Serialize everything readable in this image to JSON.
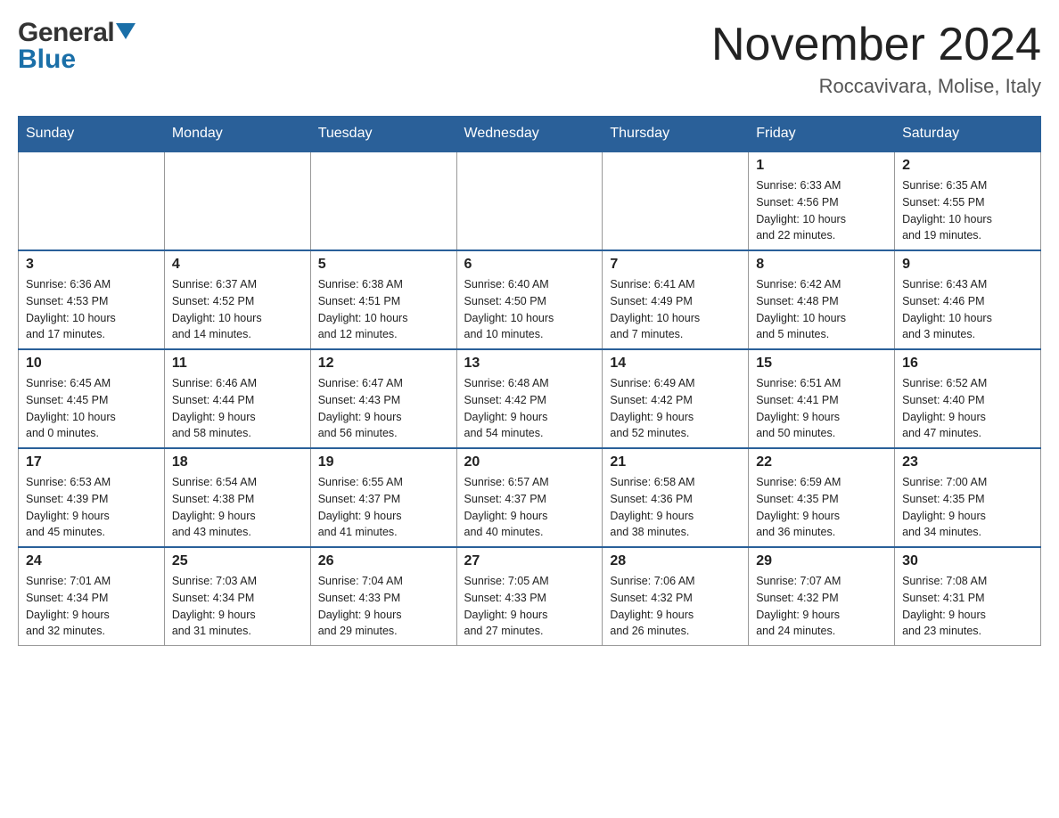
{
  "header": {
    "logo_general": "General",
    "logo_blue": "Blue",
    "month_title": "November 2024",
    "location": "Roccavivara, Molise, Italy"
  },
  "weekdays": [
    "Sunday",
    "Monday",
    "Tuesday",
    "Wednesday",
    "Thursday",
    "Friday",
    "Saturday"
  ],
  "weeks": [
    [
      {
        "day": "",
        "info": ""
      },
      {
        "day": "",
        "info": ""
      },
      {
        "day": "",
        "info": ""
      },
      {
        "day": "",
        "info": ""
      },
      {
        "day": "",
        "info": ""
      },
      {
        "day": "1",
        "info": "Sunrise: 6:33 AM\nSunset: 4:56 PM\nDaylight: 10 hours\nand 22 minutes."
      },
      {
        "day": "2",
        "info": "Sunrise: 6:35 AM\nSunset: 4:55 PM\nDaylight: 10 hours\nand 19 minutes."
      }
    ],
    [
      {
        "day": "3",
        "info": "Sunrise: 6:36 AM\nSunset: 4:53 PM\nDaylight: 10 hours\nand 17 minutes."
      },
      {
        "day": "4",
        "info": "Sunrise: 6:37 AM\nSunset: 4:52 PM\nDaylight: 10 hours\nand 14 minutes."
      },
      {
        "day": "5",
        "info": "Sunrise: 6:38 AM\nSunset: 4:51 PM\nDaylight: 10 hours\nand 12 minutes."
      },
      {
        "day": "6",
        "info": "Sunrise: 6:40 AM\nSunset: 4:50 PM\nDaylight: 10 hours\nand 10 minutes."
      },
      {
        "day": "7",
        "info": "Sunrise: 6:41 AM\nSunset: 4:49 PM\nDaylight: 10 hours\nand 7 minutes."
      },
      {
        "day": "8",
        "info": "Sunrise: 6:42 AM\nSunset: 4:48 PM\nDaylight: 10 hours\nand 5 minutes."
      },
      {
        "day": "9",
        "info": "Sunrise: 6:43 AM\nSunset: 4:46 PM\nDaylight: 10 hours\nand 3 minutes."
      }
    ],
    [
      {
        "day": "10",
        "info": "Sunrise: 6:45 AM\nSunset: 4:45 PM\nDaylight: 10 hours\nand 0 minutes."
      },
      {
        "day": "11",
        "info": "Sunrise: 6:46 AM\nSunset: 4:44 PM\nDaylight: 9 hours\nand 58 minutes."
      },
      {
        "day": "12",
        "info": "Sunrise: 6:47 AM\nSunset: 4:43 PM\nDaylight: 9 hours\nand 56 minutes."
      },
      {
        "day": "13",
        "info": "Sunrise: 6:48 AM\nSunset: 4:42 PM\nDaylight: 9 hours\nand 54 minutes."
      },
      {
        "day": "14",
        "info": "Sunrise: 6:49 AM\nSunset: 4:42 PM\nDaylight: 9 hours\nand 52 minutes."
      },
      {
        "day": "15",
        "info": "Sunrise: 6:51 AM\nSunset: 4:41 PM\nDaylight: 9 hours\nand 50 minutes."
      },
      {
        "day": "16",
        "info": "Sunrise: 6:52 AM\nSunset: 4:40 PM\nDaylight: 9 hours\nand 47 minutes."
      }
    ],
    [
      {
        "day": "17",
        "info": "Sunrise: 6:53 AM\nSunset: 4:39 PM\nDaylight: 9 hours\nand 45 minutes."
      },
      {
        "day": "18",
        "info": "Sunrise: 6:54 AM\nSunset: 4:38 PM\nDaylight: 9 hours\nand 43 minutes."
      },
      {
        "day": "19",
        "info": "Sunrise: 6:55 AM\nSunset: 4:37 PM\nDaylight: 9 hours\nand 41 minutes."
      },
      {
        "day": "20",
        "info": "Sunrise: 6:57 AM\nSunset: 4:37 PM\nDaylight: 9 hours\nand 40 minutes."
      },
      {
        "day": "21",
        "info": "Sunrise: 6:58 AM\nSunset: 4:36 PM\nDaylight: 9 hours\nand 38 minutes."
      },
      {
        "day": "22",
        "info": "Sunrise: 6:59 AM\nSunset: 4:35 PM\nDaylight: 9 hours\nand 36 minutes."
      },
      {
        "day": "23",
        "info": "Sunrise: 7:00 AM\nSunset: 4:35 PM\nDaylight: 9 hours\nand 34 minutes."
      }
    ],
    [
      {
        "day": "24",
        "info": "Sunrise: 7:01 AM\nSunset: 4:34 PM\nDaylight: 9 hours\nand 32 minutes."
      },
      {
        "day": "25",
        "info": "Sunrise: 7:03 AM\nSunset: 4:34 PM\nDaylight: 9 hours\nand 31 minutes."
      },
      {
        "day": "26",
        "info": "Sunrise: 7:04 AM\nSunset: 4:33 PM\nDaylight: 9 hours\nand 29 minutes."
      },
      {
        "day": "27",
        "info": "Sunrise: 7:05 AM\nSunset: 4:33 PM\nDaylight: 9 hours\nand 27 minutes."
      },
      {
        "day": "28",
        "info": "Sunrise: 7:06 AM\nSunset: 4:32 PM\nDaylight: 9 hours\nand 26 minutes."
      },
      {
        "day": "29",
        "info": "Sunrise: 7:07 AM\nSunset: 4:32 PM\nDaylight: 9 hours\nand 24 minutes."
      },
      {
        "day": "30",
        "info": "Sunrise: 7:08 AM\nSunset: 4:31 PM\nDaylight: 9 hours\nand 23 minutes."
      }
    ]
  ]
}
